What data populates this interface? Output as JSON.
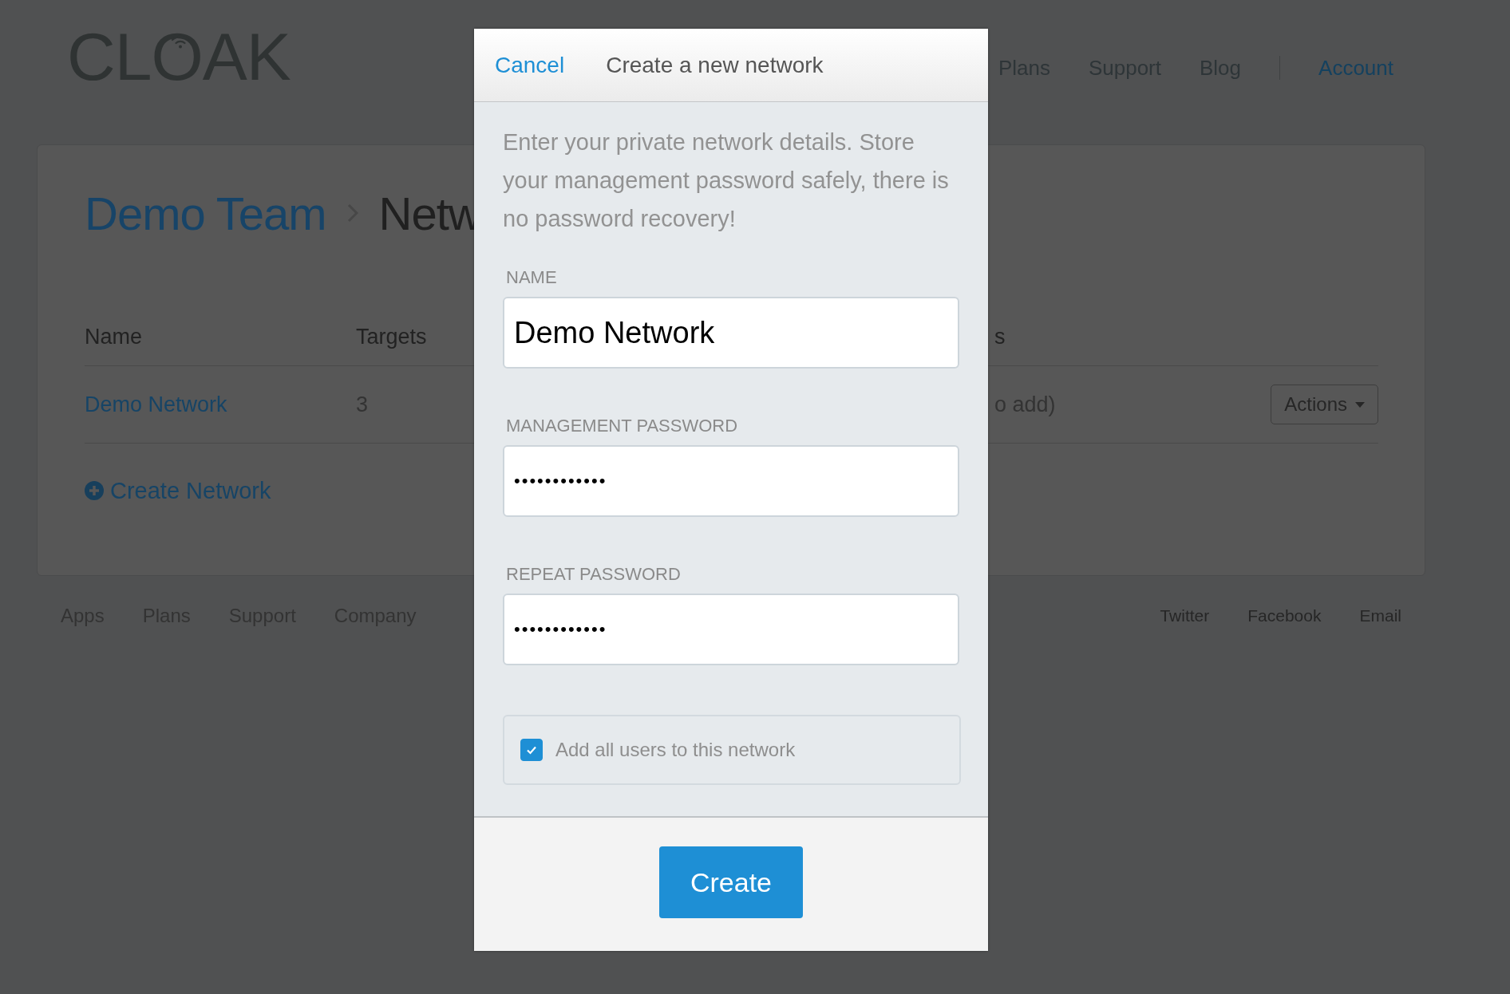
{
  "logo": {
    "text": "CLOAK"
  },
  "nav": {
    "links": [
      {
        "label": "Plans"
      },
      {
        "label": "Support"
      },
      {
        "label": "Blog"
      }
    ],
    "account": "Account"
  },
  "breadcrumb": {
    "team": "Demo Team",
    "page": "Netw"
  },
  "table": {
    "columns": [
      "Name",
      "Targets",
      "s"
    ],
    "rows": [
      {
        "name": "Demo Network",
        "targets": "3",
        "column_3": "o add)",
        "action": "Actions"
      }
    ]
  },
  "create_link": "Create Network",
  "footer": {
    "left": [
      "Apps",
      "Plans",
      "Support",
      "Company"
    ],
    "right": [
      "Twitter",
      "Facebook",
      "Email"
    ]
  },
  "modal": {
    "cancel": "Cancel",
    "title": "Create a new network",
    "description": "Enter your private network details. Store your management password safely, there is no password recovery!",
    "fields": [
      {
        "label": "NAME",
        "value": "Demo Network",
        "kind": "text"
      },
      {
        "label": "MANAGEMENT PASSWORD",
        "value": "••••••••••••",
        "kind": "password"
      },
      {
        "label": "REPEAT PASSWORD",
        "value": "••••••••••••",
        "kind": "password"
      }
    ],
    "option": {
      "label": "Add all users to this network",
      "checked": true
    },
    "submit": "Create"
  }
}
